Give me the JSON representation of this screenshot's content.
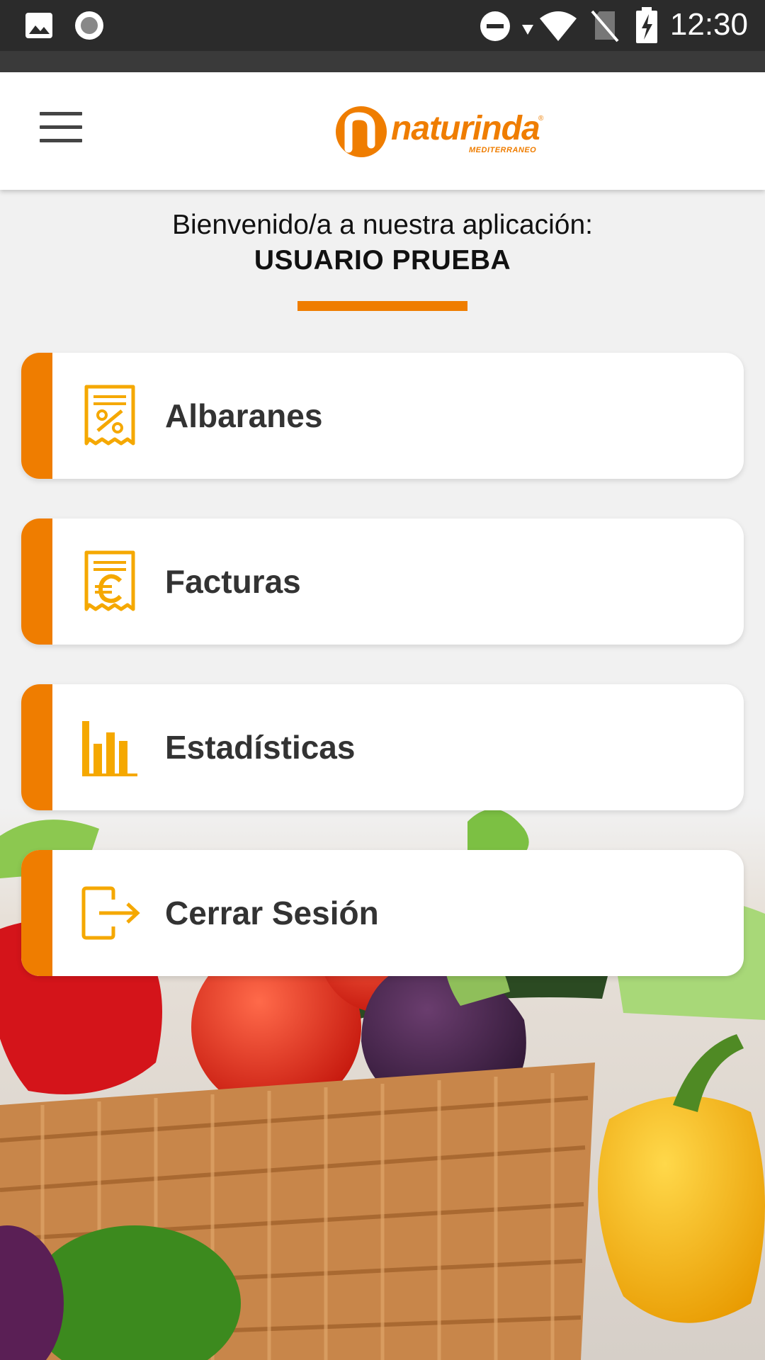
{
  "status_bar": {
    "time": "12:30",
    "icons": [
      "image-icon",
      "record-icon",
      "do-not-disturb-icon",
      "wifi-icon",
      "no-sim-icon",
      "battery-charging-icon"
    ]
  },
  "app_bar": {
    "menu_icon": "hamburger-menu-icon",
    "logo_text": "naturinda",
    "logo_subtext": "MEDITERRANEO",
    "logo_mark": "®"
  },
  "welcome": {
    "line": "Bienvenido/a a nuestra aplicación:",
    "user": "USUARIO PRUEBA"
  },
  "menu": [
    {
      "label": "Albaranes",
      "icon": "receipt-percent-icon"
    },
    {
      "label": "Facturas",
      "icon": "receipt-euro-icon"
    },
    {
      "label": "Estadísticas",
      "icon": "bar-chart-icon"
    },
    {
      "label": "Cerrar Sesión",
      "icon": "logout-icon"
    }
  ],
  "colors": {
    "accent": "#ef7d00",
    "icon": "#f5a800",
    "card_text": "#333333",
    "background": "#f1f1f1"
  }
}
